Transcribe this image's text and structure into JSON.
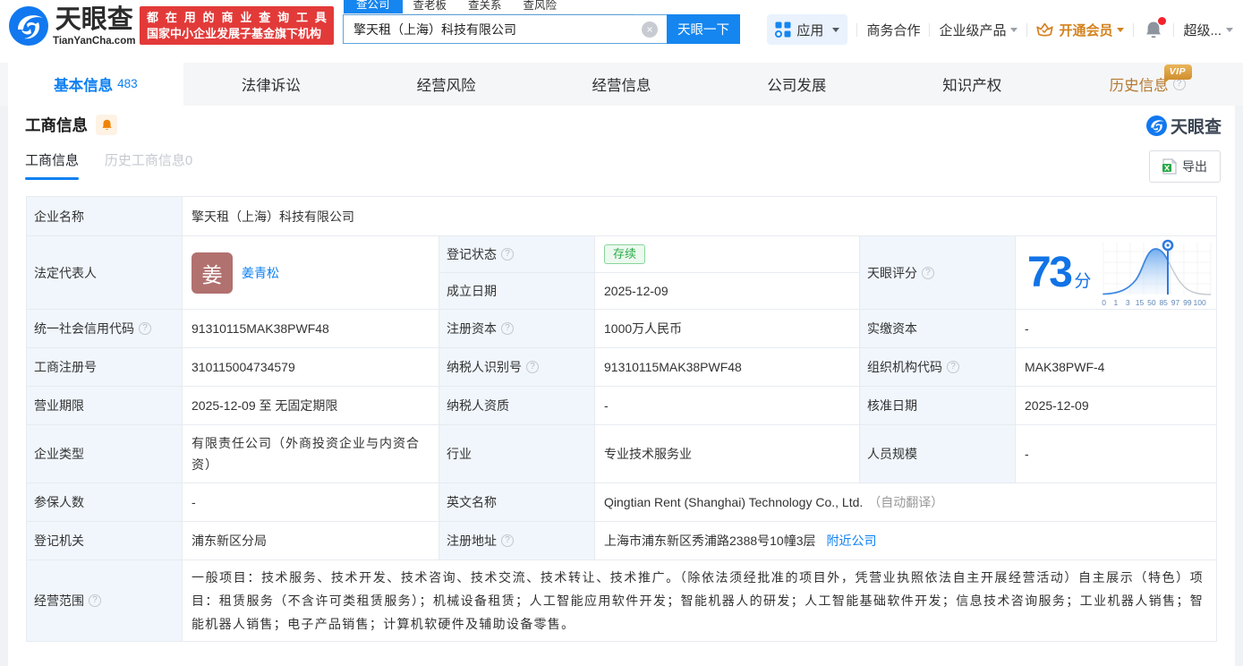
{
  "colors": {
    "brand_blue": "#1586f0",
    "link_blue": "#0d80f2",
    "banner_red": "#e23a39",
    "member_orange": "#d4821f",
    "history_tab": "#b57a33",
    "status_green": "#2dac49",
    "label_bg": "#f0f6fc",
    "avatar_bg": "#b1716f"
  },
  "header": {
    "logo": {
      "title": "天眼查",
      "domain": "TianYanCha.com"
    },
    "banner": {
      "line1": "都在用的商业查询工具",
      "line2": "国家中小企业发展子基金旗下机构"
    },
    "search": {
      "tabs": [
        {
          "label": "查公司"
        },
        {
          "label": "查老板"
        },
        {
          "label": "查关系"
        },
        {
          "label": "查风险"
        }
      ],
      "active_tab": "查公司",
      "input_value": "擎天租（上海）科技有限公司",
      "clear_icon": "×",
      "button": "天眼一下"
    },
    "menu": {
      "apps": "应用",
      "cooperation": "商务合作",
      "enterprise": "企业级产品",
      "member": "开通会员",
      "super_vip": "超级..."
    }
  },
  "nav": {
    "tabs": [
      {
        "label": "基本信息",
        "count": "483"
      },
      {
        "label": "法律诉讼"
      },
      {
        "label": "经营风险"
      },
      {
        "label": "经营信息"
      },
      {
        "label": "公司发展"
      },
      {
        "label": "知识产权"
      },
      {
        "label": "历史信息",
        "badge": "VIP"
      }
    ],
    "active": "基本信息"
  },
  "section": {
    "title": "工商信息",
    "watermark": "天眼查",
    "subtab_active": "工商信息",
    "subtab_inactive": "历史工商信息0",
    "export_label": "导出"
  },
  "table": {
    "company_name": {
      "label": "企业名称",
      "value": "擎天租（上海）科技有限公司"
    },
    "legal_rep": {
      "label": "法定代表人",
      "avatar": "姜",
      "name": "姜青松"
    },
    "reg_status": {
      "label": "登记状态",
      "value": "存续"
    },
    "establish_date": {
      "label": "成立日期",
      "value": "2025-12-09"
    },
    "credit_code": {
      "label": "统一社会信用代码",
      "value": "91310115MAK38PWF48"
    },
    "reg_capital": {
      "label": "注册资本",
      "value": "1000万人民币"
    },
    "paid_capital": {
      "label": "实缴资本",
      "value": "-"
    },
    "reg_number": {
      "label": "工商注册号",
      "value": "310115004734579"
    },
    "taxpayer_id": {
      "label": "纳税人识别号",
      "value": "91310115MAK38PWF48"
    },
    "org_code": {
      "label": "组织机构代码",
      "value": "MAK38PWF-4"
    },
    "business_term": {
      "label": "营业期限",
      "value": "2025-12-09 至 无固定期限"
    },
    "taxpayer_quality": {
      "label": "纳税人资质",
      "value": "-"
    },
    "approval_date": {
      "label": "核准日期",
      "value": "2025-12-09"
    },
    "company_type": {
      "label": "企业类型",
      "value": "有限责任公司（外商投资企业与内资合资）"
    },
    "industry": {
      "label": "行业",
      "value": "专业技术服务业"
    },
    "staff_size": {
      "label": "人员规模",
      "value": "-"
    },
    "insured_count": {
      "label": "参保人数",
      "value": "-"
    },
    "english_name": {
      "label": "英文名称",
      "value": "Qingtian Rent (Shanghai) Technology Co., Ltd.",
      "note": "（自动翻译）"
    },
    "reg_authority": {
      "label": "登记机关",
      "value": "浦东新区分局"
    },
    "reg_address": {
      "label": "注册地址",
      "value": "上海市浦东新区秀浦路2388号10幢3层",
      "link": "附近公司"
    },
    "business_scope": {
      "label": "经营范围",
      "value": "一般项目：技术服务、技术开发、技术咨询、技术交流、技术转让、技术推广。（除依法须经批准的项目外，凭营业执照依法自主开展经营活动）自主展示（特色）项目：租赁服务（不含许可类租赁服务）；机械设备租赁；人工智能应用软件开发；智能机器人的研发；人工智能基础软件开发；信息技术咨询服务；工业机器人销售；智能机器人销售；电子产品销售；计算机软硬件及辅助设备零售。"
    }
  },
  "score": {
    "label": "天眼评分",
    "value": "73",
    "unit": "分",
    "axis": [
      "0",
      "1",
      "3",
      "15",
      "50",
      "85",
      "97",
      "99",
      "100"
    ]
  }
}
